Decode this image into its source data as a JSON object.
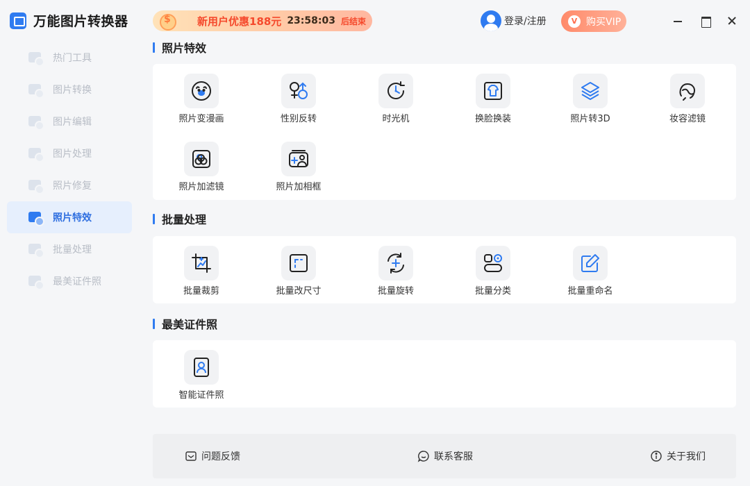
{
  "app": {
    "title": "万能图片转换器"
  },
  "sidebar": {
    "items": [
      {
        "label": "热门工具",
        "icon": "grid-icon",
        "active": false
      },
      {
        "label": "图片转换",
        "icon": "image-convert-icon",
        "active": false
      },
      {
        "label": "图片编辑",
        "icon": "image-edit-icon",
        "active": false
      },
      {
        "label": "图片处理",
        "icon": "image-process-icon",
        "active": false
      },
      {
        "label": "照片修复",
        "icon": "photo-repair-icon",
        "active": false
      },
      {
        "label": "照片特效",
        "icon": "photo-effects-icon",
        "active": true
      },
      {
        "label": "批量处理",
        "icon": "batch-icon",
        "active": false
      },
      {
        "label": "最美证件照",
        "icon": "id-photo-icon",
        "active": false
      }
    ]
  },
  "header": {
    "promo_text": "新用户优惠188元",
    "countdown": "23:58:03",
    "promo_end": "后结束",
    "login_label": "登录/注册",
    "vip_badge": "V",
    "vip_label": "购买VIP"
  },
  "sections": [
    {
      "title": "照片特效",
      "tools": [
        {
          "label": "照片变漫画",
          "icon": "cartoon-face-icon"
        },
        {
          "label": "性别反转",
          "icon": "gender-swap-icon"
        },
        {
          "label": "时光机",
          "icon": "time-machine-icon"
        },
        {
          "label": "换脸换装",
          "icon": "face-outfit-swap-icon"
        },
        {
          "label": "照片转3D",
          "icon": "layers-3d-icon"
        },
        {
          "label": "妆容滤镜",
          "icon": "makeup-filter-icon"
        },
        {
          "label": "照片加滤镜",
          "icon": "photo-filter-icon"
        },
        {
          "label": "照片加相框",
          "icon": "photo-frame-icon"
        }
      ]
    },
    {
      "title": "批量处理",
      "tools": [
        {
          "label": "批量裁剪",
          "icon": "crop-icon"
        },
        {
          "label": "批量改尺寸",
          "icon": "resize-icon"
        },
        {
          "label": "批量旋转",
          "icon": "rotate-icon"
        },
        {
          "label": "批量分类",
          "icon": "classify-icon"
        },
        {
          "label": "批量重命名",
          "icon": "rename-icon"
        }
      ]
    },
    {
      "title": "最美证件照",
      "tools": [
        {
          "label": "智能证件照",
          "icon": "id-photo-icon"
        }
      ]
    }
  ],
  "footer": {
    "feedback": "问题反馈",
    "contact": "联系客服",
    "about": "关于我们"
  },
  "colors": {
    "accent": "#2f7bf0",
    "promo_red": "#f5492c",
    "vip": "#ff8a6a"
  }
}
